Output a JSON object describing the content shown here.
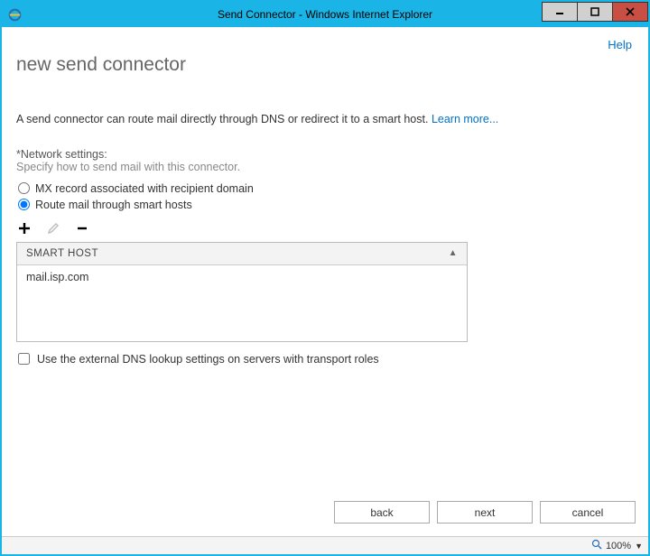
{
  "window": {
    "title": "Send Connector - Windows Internet Explorer"
  },
  "header": {
    "help": "Help",
    "page_title": "new send connector"
  },
  "description": {
    "text": "A send connector can route mail directly through DNS or redirect it to a smart host. ",
    "learn_more": "Learn more..."
  },
  "network": {
    "label": "*Network settings:",
    "sub": "Specify how to send mail with this connector.",
    "radio_mx": "MX record associated with recipient domain",
    "radio_sh": "Route mail through smart hosts",
    "selected": "sh"
  },
  "grid": {
    "header": "SMART HOST",
    "rows": [
      "mail.isp.com"
    ]
  },
  "checkbox": {
    "label": "Use the external DNS lookup settings on servers with transport roles",
    "checked": false
  },
  "buttons": {
    "back": "back",
    "next": "next",
    "cancel": "cancel"
  },
  "status": {
    "zoom": "100%"
  }
}
